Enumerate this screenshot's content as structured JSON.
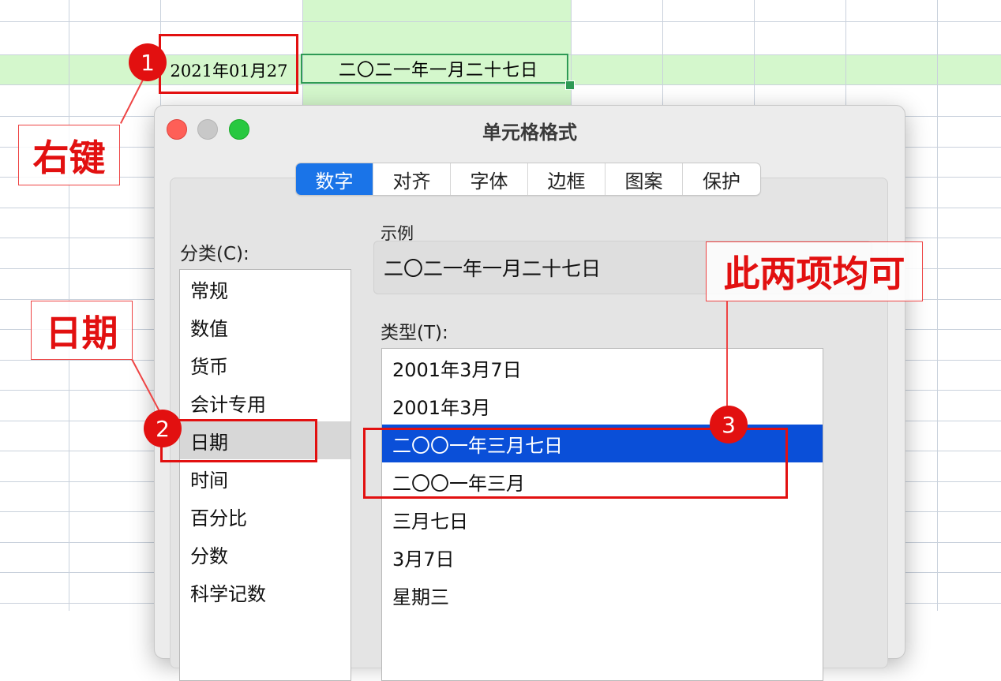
{
  "spreadsheet": {
    "cell_original": "2021年01月27",
    "cell_formatted": "二〇二一年一月二十七日"
  },
  "dialog": {
    "title": "单元格格式",
    "tabs": [
      "数字",
      "对齐",
      "字体",
      "边框",
      "图案",
      "保护"
    ],
    "active_tab": "数字",
    "category_label": "分类(C):",
    "categories": [
      "常规",
      "数值",
      "货币",
      "会计专用",
      "日期",
      "时间",
      "百分比",
      "分数",
      "科学记数"
    ],
    "selected_category": "日期",
    "sample_label": "示例",
    "sample_value": "二〇二一年一月二十七日",
    "type_label": "类型(T):",
    "types": [
      "2001年3月7日",
      "2001年3月",
      "二〇〇一年三月七日",
      "二〇〇一年三月",
      "三月七日",
      "3月7日",
      "星期三"
    ],
    "selected_type": "二〇〇一年三月七日"
  },
  "annotations": {
    "step1_number": "1",
    "step1_label": "右键",
    "step2_number": "2",
    "step2_label": "日期",
    "step3_number": "3",
    "step3_label": "此两项均可"
  },
  "colors": {
    "annotation_red": "#e21010",
    "selection_blue": "#0a4fd8",
    "tab_active_blue": "#1a74e8",
    "highlight_green": "#d4f7cc",
    "cell_border_green": "#2e9a55"
  }
}
